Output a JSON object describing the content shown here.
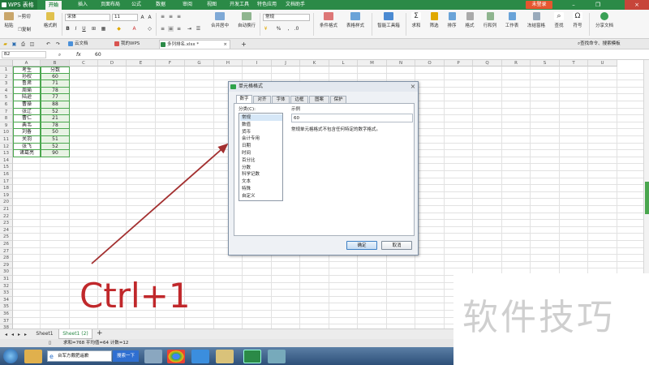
{
  "app": {
    "logo": "WPS 表格",
    "login": "未登录"
  },
  "menu": [
    "开始",
    "插入",
    "页面布局",
    "公式",
    "数据",
    "审阅",
    "视图",
    "开发工具",
    "特色应用",
    "文档助手"
  ],
  "menu_active": "开始",
  "window_buttons": [
    "–",
    "❐",
    "×"
  ],
  "ribbon": {
    "paste": "粘贴",
    "cut": "剪切",
    "copy": "复制",
    "format_painter": "格式刷",
    "font": "宋体",
    "font_size": "11",
    "number_format": "常规",
    "merge_center": "合并居中",
    "wrap_text": "自动换行",
    "cond_format": "条件格式",
    "table_style": "表格样式",
    "smart_toolbox": "智能工具箱",
    "sum": "求和",
    "filter": "筛选",
    "sort": "排序",
    "format": "格式",
    "row_col": "行和列",
    "worksheet": "工作表",
    "freeze": "冻结窗格",
    "find": "查找",
    "symbol": "符号",
    "share": "分享文档"
  },
  "doc_tabs": [
    "云文档",
    "我的WPS",
    "多列排名.xlsx *"
  ],
  "search_hint": "查找命令、搜索模板",
  "formula_bar": {
    "cell_ref": "B2",
    "fx": "fx",
    "value": "60"
  },
  "columns": [
    "A",
    "B",
    "C",
    "D",
    "E",
    "F",
    "G",
    "H",
    "I",
    "J",
    "K",
    "L",
    "M",
    "N",
    "O",
    "P",
    "Q",
    "R",
    "S",
    "T",
    "U"
  ],
  "rows": [
    "1",
    "2",
    "3",
    "4",
    "5",
    "6",
    "7",
    "8",
    "9",
    "10",
    "11",
    "12",
    "13",
    "14",
    "15",
    "16",
    "17",
    "18",
    "19",
    "20",
    "21",
    "22",
    "23",
    "24",
    "25",
    "26",
    "27",
    "28",
    "29",
    "30",
    "31",
    "32",
    "33",
    "34",
    "35",
    "36",
    "37",
    "38"
  ],
  "table": {
    "headers": [
      "考生",
      "分数"
    ],
    "data": [
      [
        "孙权",
        "60"
      ],
      [
        "鲁肃",
        "71"
      ],
      [
        "周瑜",
        "78"
      ],
      [
        "陆逊",
        "77"
      ],
      [
        "曹操",
        "88"
      ],
      [
        "张辽",
        "52"
      ],
      [
        "曹仁",
        "21"
      ],
      [
        "典韦",
        "78"
      ],
      [
        "刘备",
        "50"
      ],
      [
        "关羽",
        "51"
      ],
      [
        "张飞",
        "52"
      ],
      [
        "诸葛亮",
        "90"
      ]
    ]
  },
  "dialog": {
    "title": "单元格格式",
    "tabs": [
      "数字",
      "对齐",
      "字体",
      "边框",
      "图案",
      "保护"
    ],
    "active_tab": "数字",
    "category_label": "分类(C):",
    "categories": [
      "常规",
      "数值",
      "货币",
      "会计专用",
      "日期",
      "时间",
      "百分比",
      "分数",
      "科学记数",
      "文本",
      "特殊",
      "自定义"
    ],
    "selected_category": "常规",
    "sample_label": "示例",
    "sample_value": "60",
    "description": "常规单元格格式不包含任何特定的数字格式。",
    "ok": "确定",
    "cancel": "取消"
  },
  "sheet_tabs": [
    "Sheet1",
    "Sheet1 (2)"
  ],
  "active_sheet": "Sheet1 (2)",
  "status": "求和=768  平均值=64  计数=12",
  "taskbar": {
    "ie_text": "台军方戴肥遥歉",
    "search_btn": "搜索一下"
  },
  "overlay_text": "Ctrl+1",
  "watermark": "软件技巧",
  "colors": {
    "accent": "#2b8a47",
    "table_border": "#4aa64e",
    "overlay": "#c0282b",
    "arrow": "#a33030"
  }
}
